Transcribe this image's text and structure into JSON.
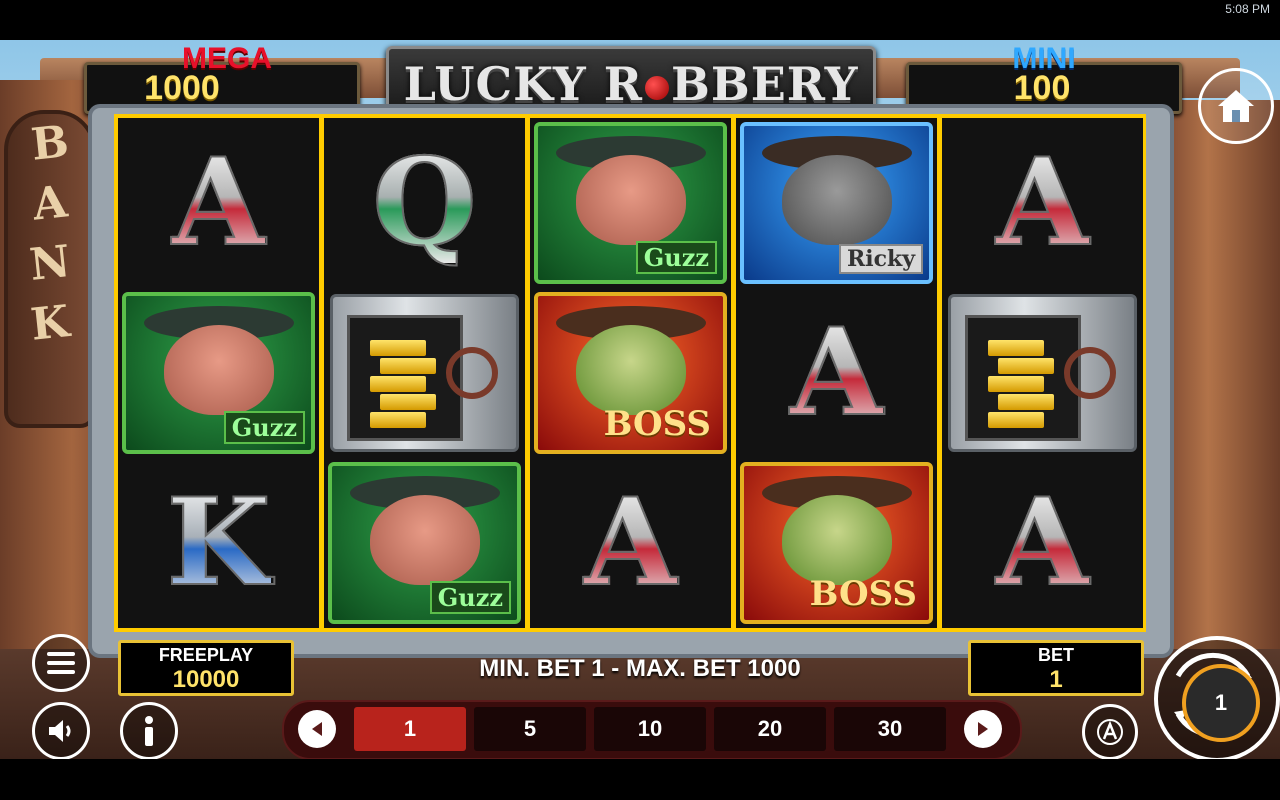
{
  "status_bar": {
    "time": "5:08 PM"
  },
  "game": {
    "title_left": "LUCKY",
    "title_right": "R",
    "title_right_tail": "BBERY"
  },
  "jackpots": {
    "mega": {
      "label": "MEGA",
      "value": "1000"
    },
    "mini": {
      "label": "MINI",
      "value": "100"
    }
  },
  "background": {
    "sign_letters": [
      "B",
      "A",
      "N",
      "K"
    ]
  },
  "reels": [
    [
      "A",
      "pig:Guzz",
      "K"
    ],
    [
      "Q",
      "safe",
      "pig:Guzz"
    ],
    [
      "pig:Guzz",
      "croc:BOSS",
      "A"
    ],
    [
      "rat:Ricky",
      "A",
      "croc:BOSS"
    ],
    [
      "A",
      "safe",
      "A"
    ]
  ],
  "character_names": {
    "pig": "Guzz",
    "croc": "BOSS",
    "rat": "Ricky"
  },
  "freeplay": {
    "label": "FREEPLAY",
    "value": "10000"
  },
  "bet": {
    "label": "BET",
    "value": "1"
  },
  "bet_limits": "MIN. BET 1 - MAX. BET 1000",
  "bet_options": [
    "1",
    "5",
    "10",
    "20",
    "30"
  ],
  "selected_bet": "1",
  "spin": {
    "badge": "1"
  },
  "icons": {
    "home": "home-icon",
    "menu": "menu-icon",
    "sound": "speaker-icon",
    "info": "info-icon",
    "auto": "autoplay-icon",
    "spin": "spin-icon",
    "prev": "arrow-left-icon",
    "next": "arrow-right-icon"
  },
  "colors": {
    "mega": "#e8102a",
    "mini": "#2fa8ff",
    "gold": "#ffe36a",
    "frame": "#ffcc00",
    "active_bet": "#b8231c"
  }
}
